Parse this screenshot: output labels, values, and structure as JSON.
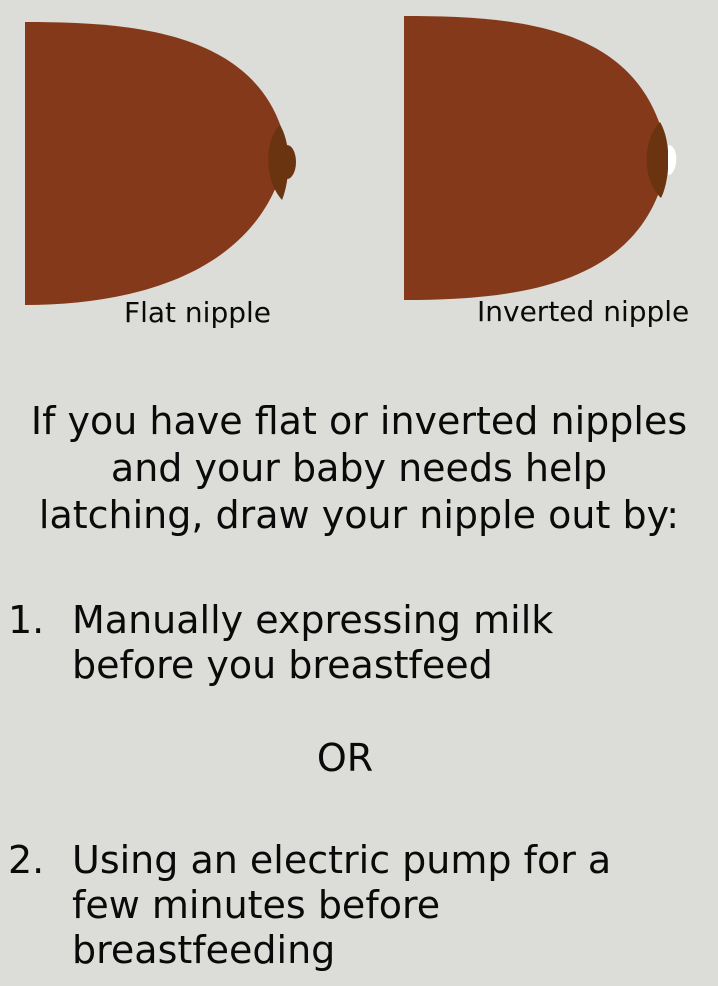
{
  "figures": [
    {
      "label": "Flat nipple"
    },
    {
      "label": "Inverted nipple"
    }
  ],
  "colors": {
    "background": "#dcdcd8",
    "breast": "#84391a",
    "areola": "#6a3410",
    "nipple_inverted": "#ffffff"
  },
  "intro": {
    "lines": [
      "If you have flat or inverted nipples",
      "and your baby needs help",
      "latching, draw your nipple out by:"
    ]
  },
  "steps": [
    {
      "number": "1.",
      "lines": [
        "Manually expressing milk",
        "before you breastfeed"
      ]
    },
    {
      "number": "2.",
      "lines": [
        "Using an electric pump for a",
        "few minutes before",
        "breastfeeding"
      ]
    }
  ],
  "separator": "OR"
}
